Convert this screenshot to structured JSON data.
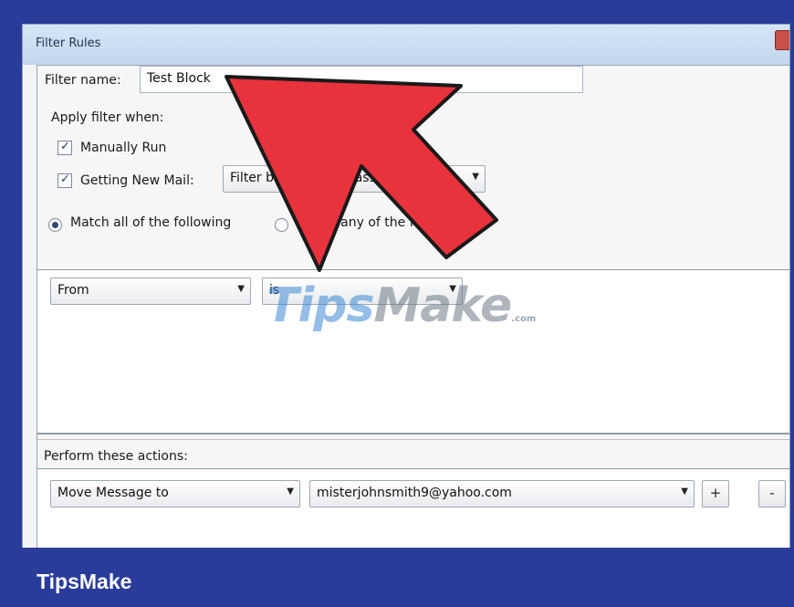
{
  "window": {
    "title": "Filter Rules"
  },
  "filter": {
    "name_label": "Filter name:",
    "name_value": "Test Block"
  },
  "apply": {
    "heading": "Apply filter when:",
    "manual_label": "Manually Run",
    "new_mail_label": "Getting New Mail:",
    "new_mail_option": "Filter before Junk Classification"
  },
  "match": {
    "all_label": "Match all of the following",
    "any_label": "Match any of the following"
  },
  "criteria": {
    "field": "From",
    "operator": "is"
  },
  "watermark": {
    "left": "T",
    "middle": "ips",
    "right": "Make",
    "suffix": ".com"
  },
  "actions": {
    "heading": "Perform these actions:",
    "action": "Move Message to",
    "target": "misterjohnsmith9@yahoo.com",
    "add_label": "+",
    "remove_label": "-"
  },
  "footer": {
    "brand": "TipsMake"
  },
  "colors": {
    "arrow": "#e8323c",
    "frame": "#2a3c9a"
  }
}
